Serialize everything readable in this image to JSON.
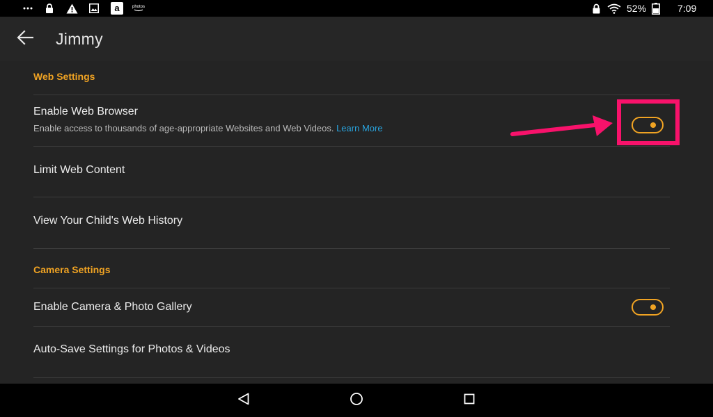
{
  "status_bar": {
    "left_icons": [
      "more-dots-icon",
      "lock-icon",
      "warning-icon",
      "image-icon",
      "amazon-icon",
      "photos-icon"
    ],
    "photos_label": "photos",
    "battery_percent": "52%",
    "time": "7:09"
  },
  "app_bar": {
    "back_icon": "arrow-left-icon",
    "title": "Jimmy"
  },
  "sections": {
    "web": {
      "header": "Web Settings",
      "enable_browser": {
        "title": "Enable Web Browser",
        "subtitle": "Enable access to thousands of age-appropriate Websites and Web Videos.",
        "link": "Learn More",
        "toggle_on": true
      },
      "limit_content": {
        "title": "Limit Web Content"
      },
      "history": {
        "title": "View Your Child's Web History"
      }
    },
    "camera": {
      "header": "Camera Settings",
      "enable_camera": {
        "title": "Enable Camera & Photo Gallery",
        "toggle_on": true
      },
      "auto_save": {
        "title": "Auto-Save Settings for Photos & Videos"
      }
    }
  },
  "nav_bar": {
    "buttons": [
      "back-triangle-icon",
      "home-circle-icon",
      "recents-square-icon"
    ]
  },
  "colors": {
    "accent": "#f0a323",
    "link": "#29a3dd",
    "annotation": "#f8126b",
    "app_bar": "#262626",
    "content_bg": "#242424"
  }
}
